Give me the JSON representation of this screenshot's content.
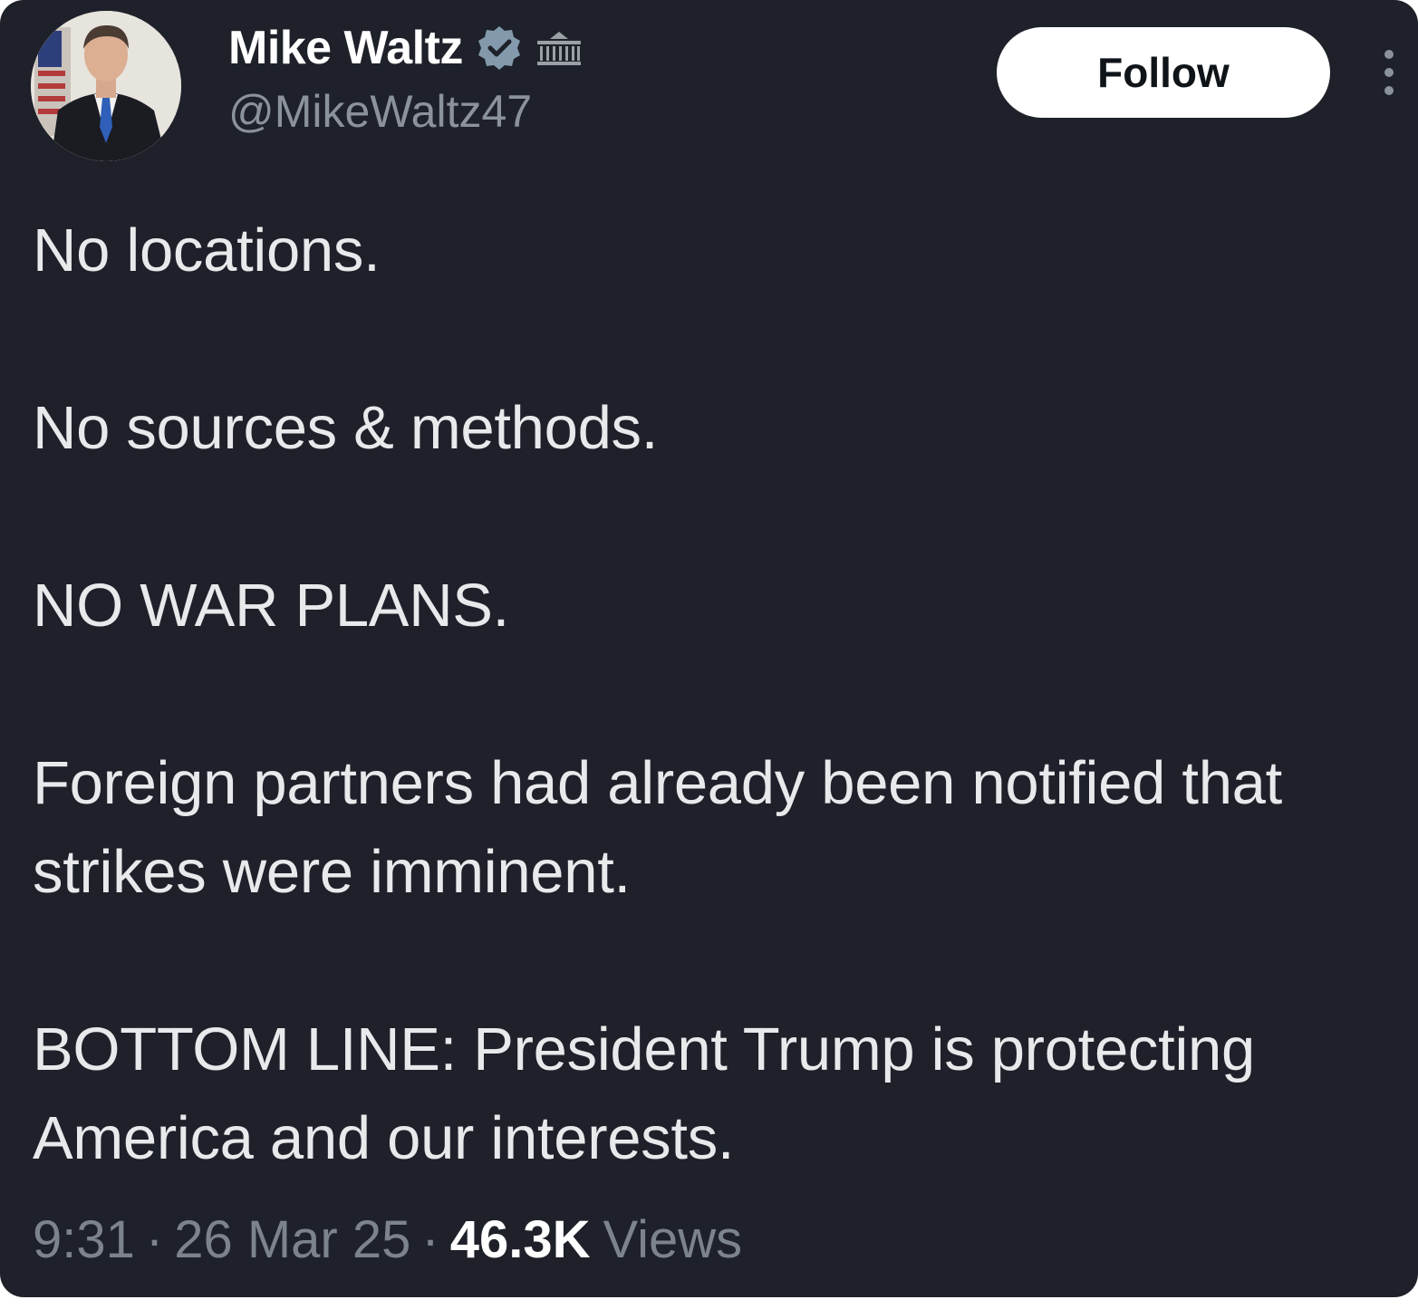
{
  "tweet": {
    "author": {
      "display_name": "Mike Waltz",
      "handle": "@MikeWaltz47",
      "verified_icon": "verified-badge-icon",
      "affiliation_icon": "white-house-icon",
      "avatar_icon": "profile-photo-avatar"
    },
    "follow_label": "Follow",
    "more_icon": "more-options-icon",
    "paragraphs": [
      "No locations.",
      "No sources & methods.",
      "NO WAR PLANS.",
      "Foreign partners had already been notified that strikes were imminent.",
      "BOTTOM LINE:  President Trump is protecting America and our interests."
    ],
    "time": "9:31",
    "date": "26 Mar 25",
    "views_count": "46.3K",
    "views_label": "Views",
    "separator": "·"
  },
  "colors": {
    "background": "#1e212a",
    "text": "#e8e9eb",
    "muted": "#7d838b",
    "verified": "#829aab",
    "button": "#ffffff"
  }
}
